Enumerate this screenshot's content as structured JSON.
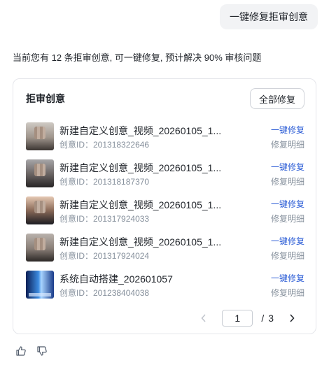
{
  "user_message": "一键修复拒审创意",
  "summary": "当前您有 12 条拒审创意, 可一键修复, 预计解决 90% 审核问题",
  "card": {
    "title": "拒审创意",
    "fix_all_label": "全部修复",
    "rows": [
      {
        "title": "新建自定义创意_视频_20260105_1...",
        "id": "创意ID：201318322646",
        "fix": "一键修复",
        "detail": "修复明细",
        "thumb": "person-thumbnail"
      },
      {
        "title": "新建自定义创意_视频_20260105_1...",
        "id": "创意ID：201318187370",
        "fix": "一键修复",
        "detail": "修复明细",
        "thumb": "person-thumbnail"
      },
      {
        "title": "新建自定义创意_视频_20260105_1...",
        "id": "创意ID：201317924033",
        "fix": "一键修复",
        "detail": "修复明细",
        "thumb": "person-thumbnail"
      },
      {
        "title": "新建自定义创意_视频_20260105_1...",
        "id": "创意ID：201317924024",
        "fix": "一键修复",
        "detail": "修复明细",
        "thumb": "person-thumbnail"
      },
      {
        "title": "系统自动搭建_202601057",
        "id": "创意ID：201238404038",
        "fix": "一键修复",
        "detail": "修复明细",
        "thumb": "blue-thumbnail"
      }
    ],
    "pagination": {
      "current": "1",
      "separator": "/",
      "total": "3"
    }
  },
  "colors": {
    "link": "#2b5cd6",
    "muted": "#86909c",
    "border": "#e5e6eb"
  }
}
